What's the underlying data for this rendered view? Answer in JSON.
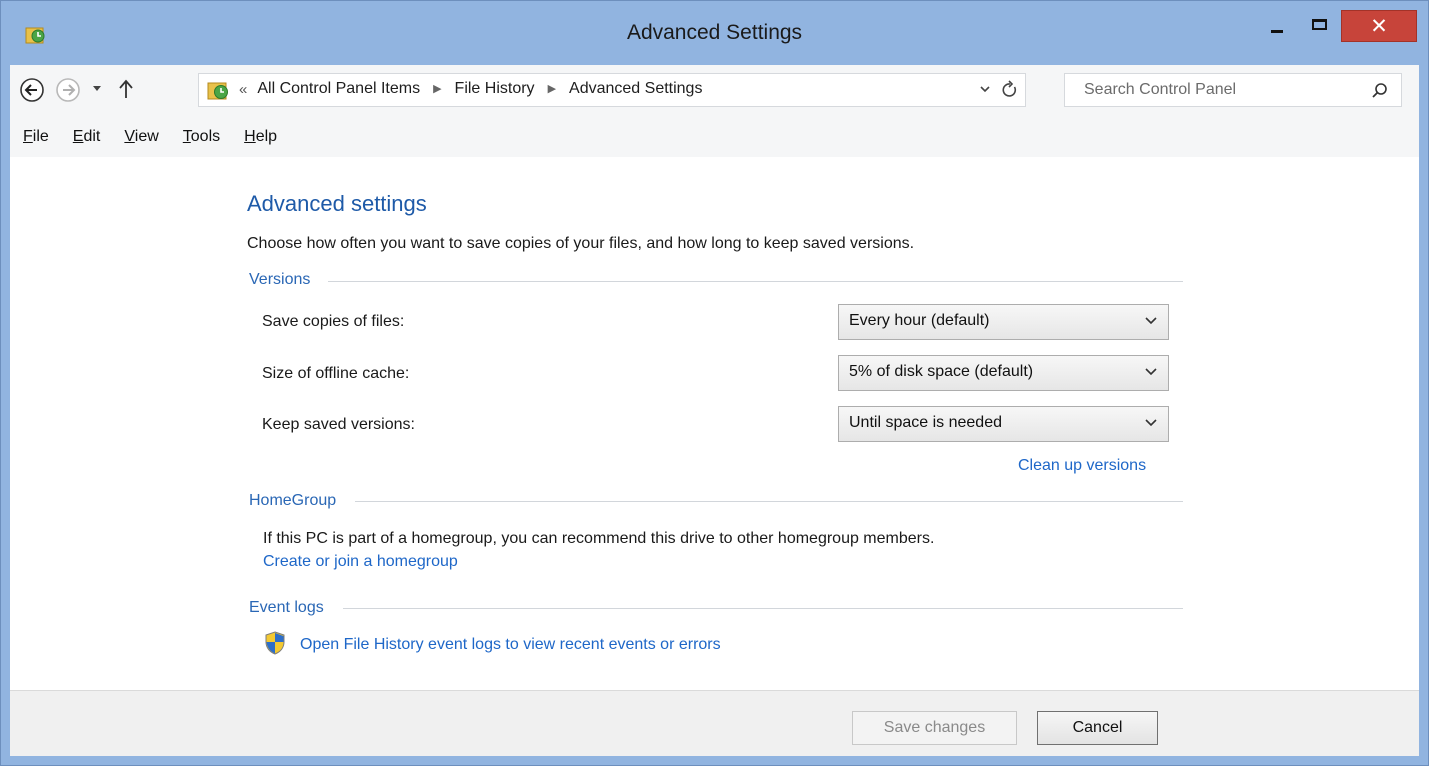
{
  "window": {
    "title": "Advanced Settings",
    "close_glyph": "✕",
    "accent": "#91b4e0"
  },
  "address_bar": {
    "lead": "«",
    "crumbs": [
      "All Control Panel Items",
      "File History",
      "Advanced Settings"
    ],
    "search_placeholder": "Search Control Panel"
  },
  "menu": [
    {
      "accel": "F",
      "rest": "ile"
    },
    {
      "accel": "E",
      "rest": "dit"
    },
    {
      "accel": "V",
      "rest": "iew"
    },
    {
      "accel": "T",
      "rest": "ools"
    },
    {
      "accel": "H",
      "rest": "elp"
    }
  ],
  "content": {
    "title": "Advanced settings",
    "intro": "Choose how often you want to save copies of your files, and how long to keep saved versions.",
    "versions": {
      "heading": "Versions",
      "rows": [
        {
          "label": "Save copies of files:",
          "value": "Every hour (default)"
        },
        {
          "label": "Size of offline cache:",
          "value": "5% of disk space (default)"
        },
        {
          "label": "Keep saved versions:",
          "value": "Until space is needed"
        }
      ],
      "cleanup_link": "Clean up versions"
    },
    "homegroup": {
      "heading": "HomeGroup",
      "text": "If this PC is part of a homegroup, you can recommend this drive to other homegroup members.",
      "link": "Create or join a homegroup"
    },
    "event_logs": {
      "heading": "Event logs",
      "link": "Open File History event logs to view recent events or errors"
    }
  },
  "footer": {
    "save_label": "Save changes",
    "cancel_label": "Cancel"
  }
}
